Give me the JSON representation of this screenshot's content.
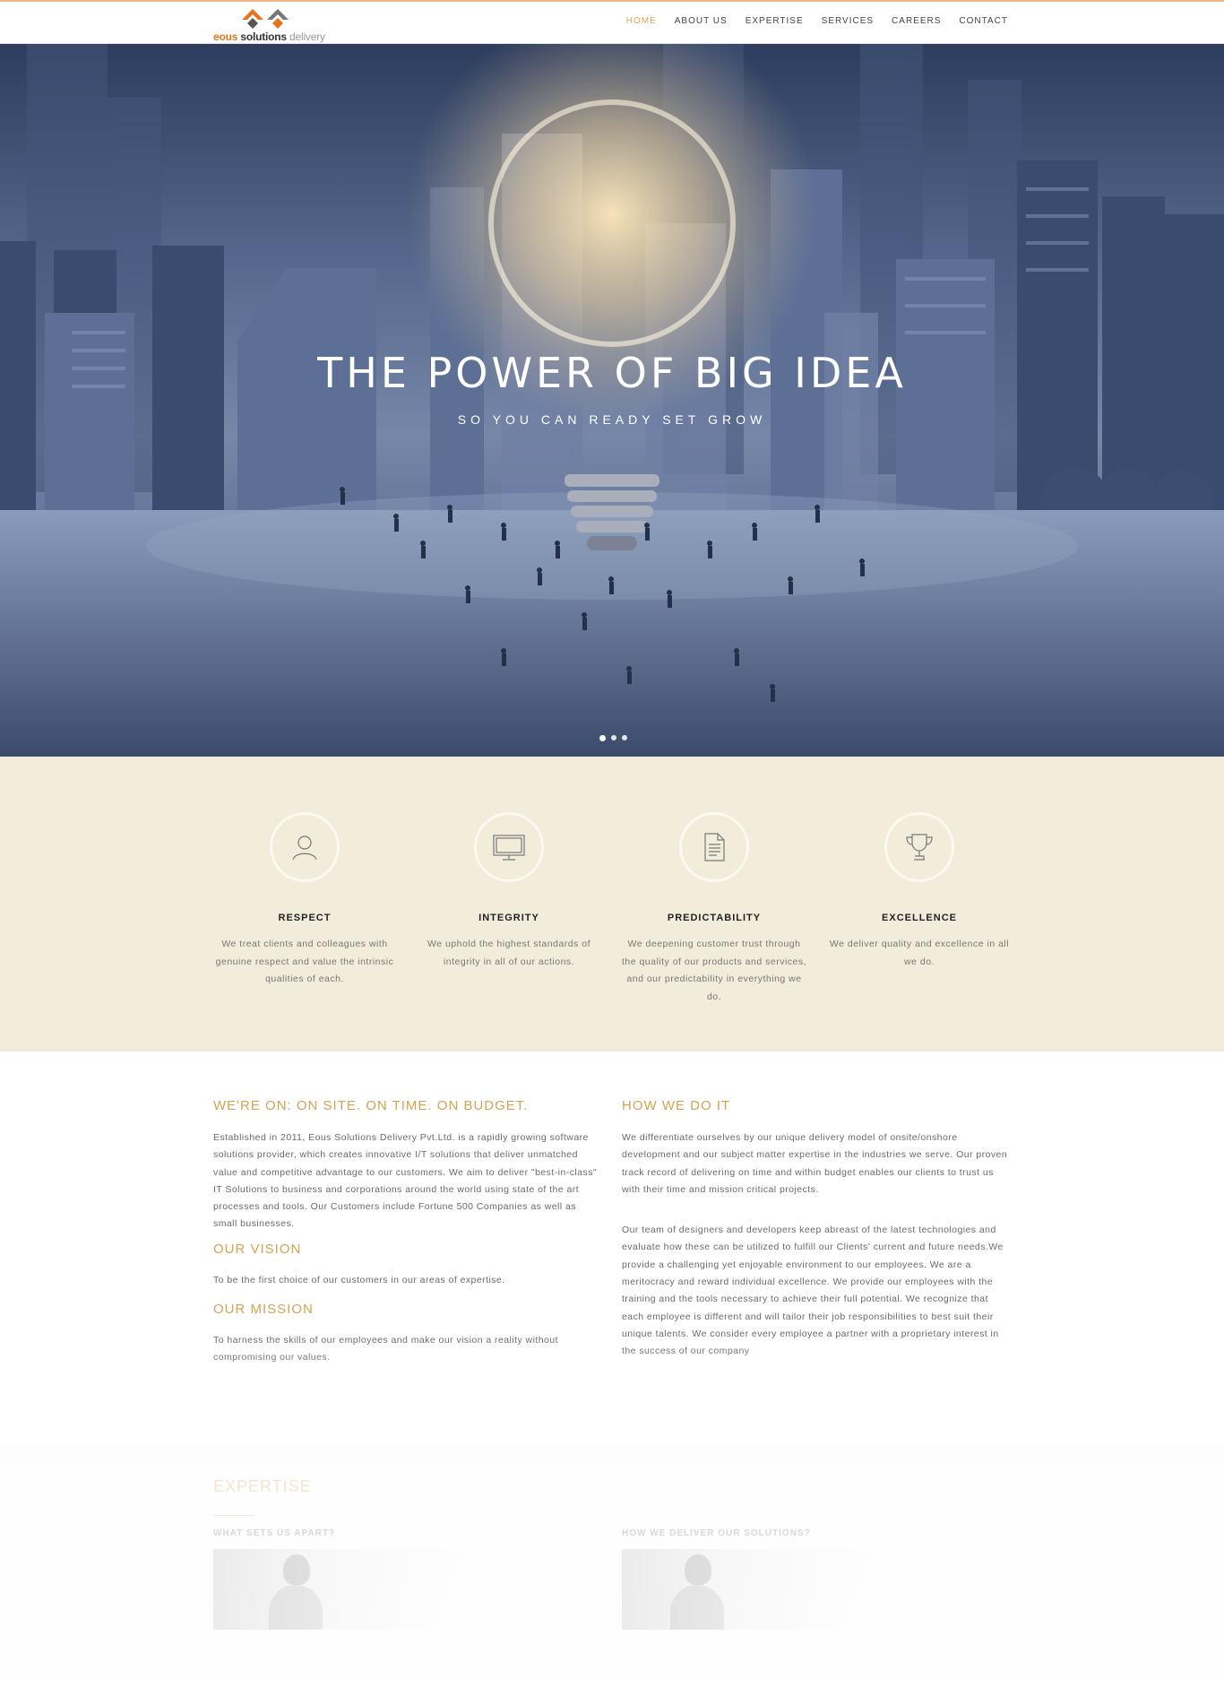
{
  "header": {
    "logo": {
      "word1": "eous",
      "word2": "solutions",
      "word3": "delivery"
    },
    "nav": [
      {
        "label": "HOME"
      },
      {
        "label": "ABOUT US"
      },
      {
        "label": "EXPERTISE"
      },
      {
        "label": "SERVICES"
      },
      {
        "label": "CAREERS"
      },
      {
        "label": "CONTACT"
      }
    ],
    "active_nav_color": "#e3a25a"
  },
  "hero": {
    "title": "THE POWER OF BIG IDEA",
    "subtitle": "SO YOU CAN READY SET GROW",
    "slide_count": 3,
    "active_slide": 1
  },
  "values": [
    {
      "icon": "user-icon",
      "title": "RESPECT",
      "text": "We treat clients and colleagues with genuine respect and value the intrinsic qualities of each."
    },
    {
      "icon": "monitor-icon",
      "title": "INTEGRITY",
      "text": "We uphold the highest standards of integrity in all of our actions."
    },
    {
      "icon": "document-icon",
      "title": "PREDICTABILITY",
      "text": "We deepening customer trust through the quality of our products and services, and our predictability in everything we do."
    },
    {
      "icon": "trophy-icon",
      "title": "EXCELLENCE",
      "text": "We deliver quality and excellence in all we do."
    }
  ],
  "about": {
    "left": {
      "heading": "WE'RE ON: ON SITE. ON TIME. ON BUDGET.",
      "text": "Established in 2011, Eous Solutions Delivery Pvt.Ltd. is a rapidly growing software solutions provider, which creates innovative I/T solutions that deliver unmatched value and competitive advantage to our customers. We aim to deliver \"best-in-class\" IT Solutions to business and corporations around the world using state of the art processes and tools. Our Customers include Fortune 500 Companies as well as small businesses.",
      "vision_heading": "OUR VISION",
      "vision_text": "To be the first choice of our customers in our areas of expertise.",
      "mission_heading": "OUR MISSION",
      "mission_text": "To harness the skills of our employees and make our vision a reality without compromising our values."
    },
    "right": {
      "heading": "HOW WE DO IT",
      "text1": "We differentiate ourselves by our unique delivery model of onsite/onshore development and our subject matter expertise in the industries we serve. Our proven track record of delivering on time and within budget enables our clients to trust us with their time and mission critical projects.",
      "text2": "Our team of designers and developers keep abreast of the latest technologies and evaluate how these can be utilized to fulfill our Clients' current and future needs.We provide a challenging yet enjoyable environment to our employees. We are a meritocracy and reward individual excellence. We provide our employees with the training and the tools necessary to achieve their full potential. We recognize that each employee is different and will tailor their job responsibilities to best suit their unique talents. We consider every employee a partner with a proprietary interest in the success of our company"
    },
    "heading_color": "#d5a253"
  },
  "expertise": {
    "title": "EXPERTISE",
    "left_sub": "WHAT SETS US APART?",
    "right_sub": "HOW WE DELIVER OUR SOLUTIONS?"
  }
}
